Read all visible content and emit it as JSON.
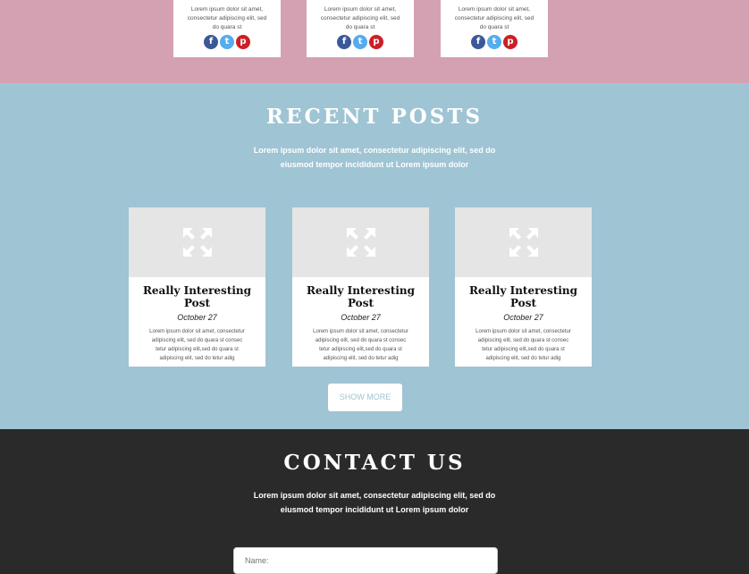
{
  "team": {
    "cards": [
      {
        "bio": "Lorem ipsum dolor sit amet, consectetur adipiscing elit, sed do quara st"
      },
      {
        "bio": "Lorem ipsum dolor sit amet, consectetur adipiscing elit, sed do quara st"
      },
      {
        "bio": "Lorem ipsum dolor sit amet, consectetur adipiscing elit, sed do quara st"
      }
    ],
    "social_icons": {
      "facebook": "f",
      "twitter": "t",
      "pinterest": "p"
    }
  },
  "recent_posts": {
    "title": "RECENT POSTS",
    "subtitle": "Lorem ipsum dolor sit amet, consectetur adipiscing elit, sed do eiusmod tempor incididunt ut Lorem ipsum dolor",
    "posts": [
      {
        "title": "Really Interesting Post",
        "date": "October 27",
        "excerpt": "Lorem ipsum dolor sit amet, consectetur adipiscing elit, sed do quara st consec tetur adipiscing elit,sed do quara st adipiscing elit, sed do tetur adig",
        "image_icon": "expand-arrows-icon"
      },
      {
        "title": "Really Interesting Post",
        "date": "October 27",
        "excerpt": "Lorem ipsum dolor sit amet, consectetur adipiscing elit, sed do quara st consec tetur adipiscing elit,sed do quara st adipiscing elit, sed do tetur adig",
        "image_icon": "expand-arrows-icon"
      },
      {
        "title": "Really Interesting Post",
        "date": "October 27",
        "excerpt": "Lorem ipsum dolor sit amet, consectetur adipiscing elit, sed do quara st consec tetur adipiscing elit,sed do quara st adipiscing elit, sed do tetur adig",
        "image_icon": "expand-arrows-icon"
      }
    ],
    "show_more_label": "SHOW MORE"
  },
  "contact": {
    "title": "CONTACT US",
    "subtitle": "Lorem ipsum dolor sit amet, consectetur adipiscing elit, sed do eiusmod tempor incididunt ut Lorem ipsum dolor",
    "name_placeholder": "Name:"
  },
  "colors": {
    "team_bg": "#d4a1b2",
    "posts_bg": "#9fc4d4",
    "contact_bg": "#2a2a2a",
    "facebook": "#3b5998",
    "twitter": "#55acee",
    "pinterest": "#cb2027"
  }
}
